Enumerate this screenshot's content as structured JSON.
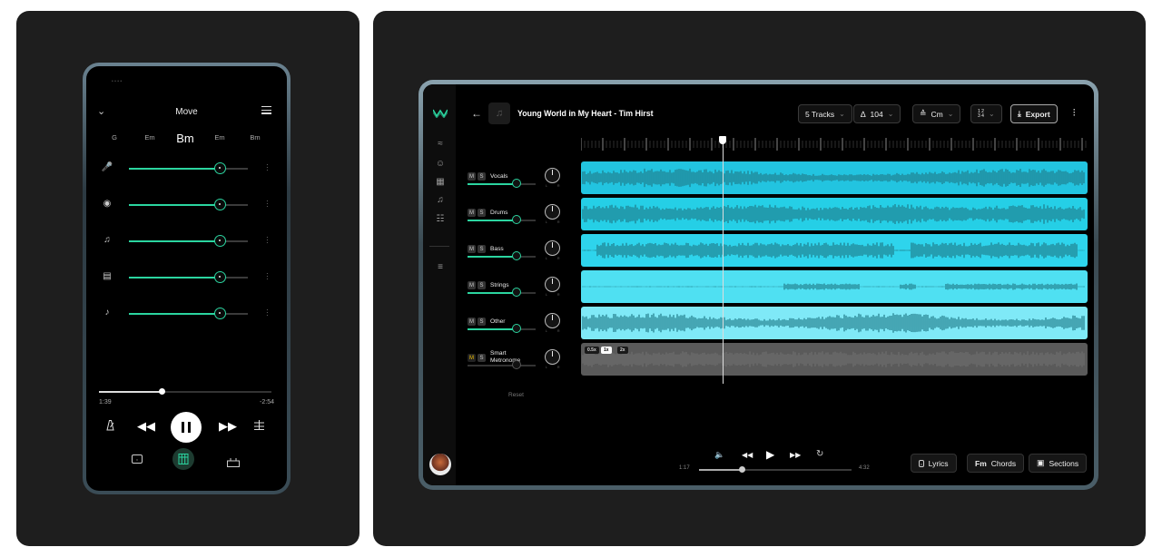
{
  "phone": {
    "title": "Move",
    "chords": [
      "G",
      "Em",
      "Bm",
      "Em",
      "Bm"
    ],
    "tracks": [
      {
        "icon": "microphone-icon",
        "level": 0.76
      },
      {
        "icon": "drum-icon",
        "level": 0.76
      },
      {
        "icon": "bass-guitar-icon",
        "level": 0.76
      },
      {
        "icon": "piano-icon",
        "level": 0.76
      },
      {
        "icon": "music-note-icon",
        "level": 0.76
      }
    ],
    "progress": 0.366,
    "time_elapsed": "1:39",
    "time_remaining": "-2:54"
  },
  "tablet": {
    "song_title": "Young World in My Heart - Tim Hirst",
    "tracks_label": "5 Tracks",
    "tempo": "104",
    "key": "Cm",
    "time_signature_top": "1 2",
    "time_signature_bottom": "3 4",
    "export_label": "Export",
    "tracks": [
      {
        "name": "Vocals",
        "mute": "M",
        "solo": "S",
        "level": 0.72
      },
      {
        "name": "Drums",
        "mute": "M",
        "solo": "S",
        "level": 0.72
      },
      {
        "name": "Bass",
        "mute": "M",
        "solo": "S",
        "level": 0.72
      },
      {
        "name": "Strings",
        "mute": "M",
        "solo": "S",
        "level": 0.72
      },
      {
        "name": "Other",
        "mute": "M",
        "solo": "S",
        "level": 0.72
      },
      {
        "name": "Smart\nMetronome",
        "mute": "M",
        "solo": "S",
        "level": 0.72
      }
    ],
    "knob_min": "L",
    "knob_max": "R",
    "reset_label": "Reset",
    "speeds": [
      "0.5x",
      "1x",
      "2x"
    ],
    "selected_speed": "1x",
    "playhead": 0.28,
    "time_elapsed": "1:17",
    "time_total": "4:32",
    "progress": 0.283,
    "lyrics_label": "Lyrics",
    "chords_label": "Chords",
    "chords_prefix": "Fm",
    "sections_label": "Sections",
    "colors": {
      "accent": "#2bd5a0",
      "lanes": [
        "#22c4e0",
        "#25cfe6",
        "#2ed4ec",
        "#4fe0f2",
        "#7fe9f7"
      ],
      "metronome_lane": "#5a5a5a"
    }
  }
}
